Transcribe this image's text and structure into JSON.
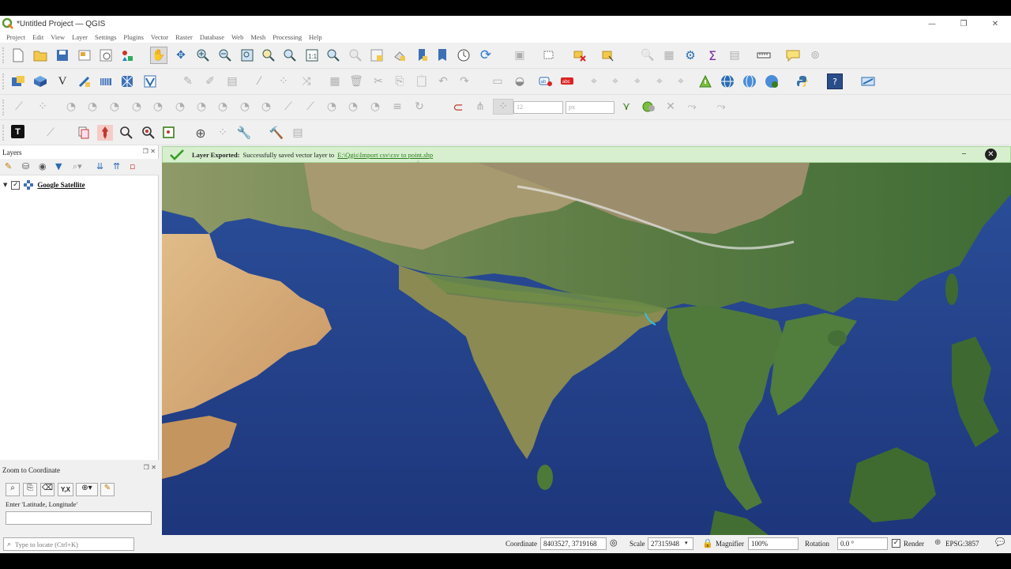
{
  "app": {
    "title": "*Untitled Project — QGIS",
    "win_minimize": "—",
    "win_maximize": "❐",
    "win_close": "✕"
  },
  "menu": [
    "Project",
    "Edit",
    "View",
    "Layer",
    "Settings",
    "Plugins",
    "Vector",
    "Raster",
    "Database",
    "Web",
    "Mesh",
    "Processing",
    "Help"
  ],
  "toolbar": {
    "font_size_value": "12",
    "unit_value": "px"
  },
  "layers_panel": {
    "title": "Layers",
    "layers": [
      {
        "name": "Google Satellite",
        "checked": true
      }
    ]
  },
  "zoom_panel": {
    "title": "Zoom to Coordinate",
    "yx_label": "Y,X",
    "input_label": "Enter 'Latitude, Longitude'",
    "input_value": ""
  },
  "message": {
    "title": "Layer Exported:",
    "text": "Successfully saved vector layer to",
    "link": "E:\\Qgis\\Import csv\\csv to point.shp"
  },
  "status": {
    "locator_placeholder": "Type to locate (Ctrl+K)",
    "coordinate_label": "Coordinate",
    "coordinate_value": "8403527, 3719168",
    "scale_label": "Scale",
    "scale_value": "27315948",
    "magnifier_label": "Magnifier",
    "magnifier_value": "100%",
    "rotation_label": "Rotation",
    "rotation_value": "0.0 °",
    "render_label": "Render",
    "crs_label": "EPSG:3857"
  },
  "colors": {
    "accent": "#589632",
    "message_bg": "#d7efcf",
    "ocean": "#1f3f86",
    "land": "#6f8a52",
    "desert": "#d8b079"
  }
}
